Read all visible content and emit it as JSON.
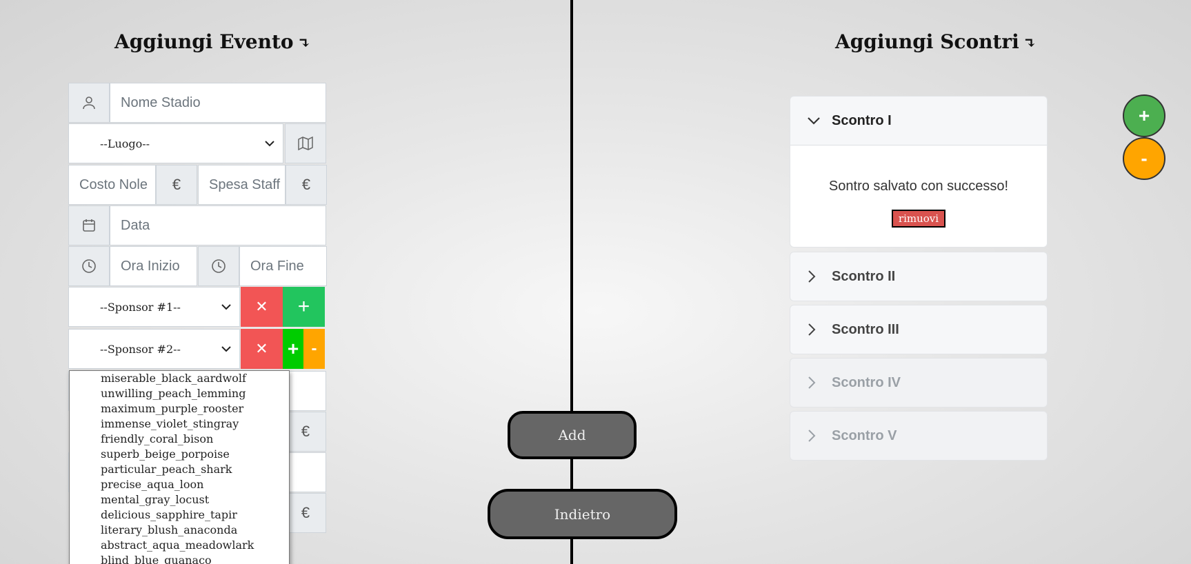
{
  "left": {
    "title": "Aggiungi Evento",
    "title_arrow": "↴",
    "fields": {
      "nome_stadio": "Nome Stadio",
      "luogo": "--Luogo--",
      "costo_noleggio": "Costo Nole",
      "spesa_staff": "Spesa Staff",
      "data": "Data",
      "ora_inizio": "Ora Inizio",
      "ora_fine": "Ora Fine",
      "sponsor1": "--Sponsor #1--",
      "sponsor2": "--Sponsor #2--"
    },
    "buttons": {
      "remove": "✕",
      "add": "+",
      "minus": "-"
    },
    "currency_symbol": "€",
    "dropdown_options": [
      "miserable_black_aardwolf",
      "unwilling_peach_lemming",
      "maximum_purple_rooster",
      "immense_violet_stingray",
      "friendly_coral_bison",
      "superb_beige_porpoise",
      "particular_peach_shark",
      "precise_aqua_loon",
      "mental_gray_locust",
      "delicious_sapphire_tapir",
      "literary_blush_anaconda",
      "abstract_aqua_meadowlark",
      "blind_blue_guanaco"
    ]
  },
  "center": {
    "add_label": "Add",
    "back_label": "Indietro"
  },
  "right": {
    "title": "Aggiungi Scontri",
    "title_arrow": "↴",
    "accordion": [
      {
        "label": "Scontro I",
        "expanded": true,
        "message": "Sontro salvato con successo!",
        "remove_label": "rimuovi"
      },
      {
        "label": "Scontro II"
      },
      {
        "label": "Scontro III"
      },
      {
        "label": "Scontro IV",
        "disabled": true
      },
      {
        "label": "Scontro V",
        "disabled": true
      }
    ],
    "add_circle": "+",
    "remove_circle": "-"
  },
  "colors": {
    "green": "#4caf50",
    "orange": "#ffa500",
    "red": "#f25555"
  }
}
